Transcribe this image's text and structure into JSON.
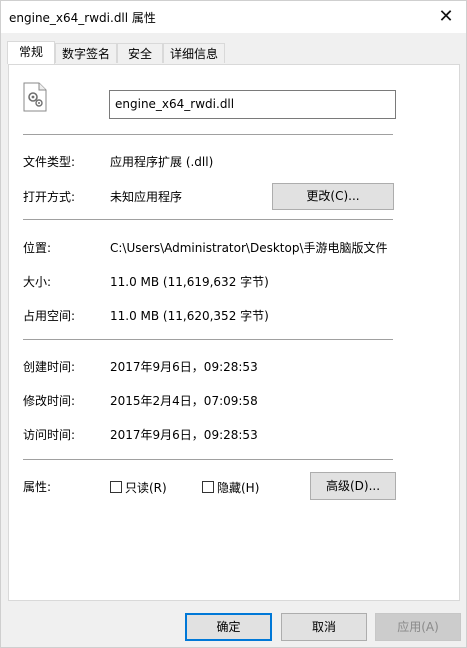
{
  "window": {
    "title": "engine_x64_rwdi.dll 属性",
    "close": "✕"
  },
  "tabs": [
    {
      "label": "常规"
    },
    {
      "label": "数字签名"
    },
    {
      "label": "安全"
    },
    {
      "label": "详细信息"
    }
  ],
  "general": {
    "filename": "engine_x64_rwdi.dll",
    "file_type_label": "文件类型:",
    "file_type_value": "应用程序扩展 (.dll)",
    "open_with_label": "打开方式:",
    "open_with_value": "未知应用程序",
    "change_button": "更改(C)...",
    "location_label": "位置:",
    "location_value": "C:\\Users\\Administrator\\Desktop\\手游电脑版文件",
    "size_label": "大小:",
    "size_value": "11.0 MB (11,619,632 字节)",
    "size_on_disk_label": "占用空间:",
    "size_on_disk_value": "11.0 MB (11,620,352 字节)",
    "created_label": "创建时间:",
    "created_value": "2017年9月6日，09:28:53",
    "modified_label": "修改时间:",
    "modified_value": "2015年2月4日，07:09:58",
    "accessed_label": "访问时间:",
    "accessed_value": "2017年9月6日，09:28:53",
    "attributes_label": "属性:",
    "readonly_label": "只读(R)",
    "hidden_label": "隐藏(H)",
    "advanced_button": "高级(D)..."
  },
  "footer": {
    "ok": "确定",
    "cancel": "取消",
    "apply": "应用(A)"
  }
}
